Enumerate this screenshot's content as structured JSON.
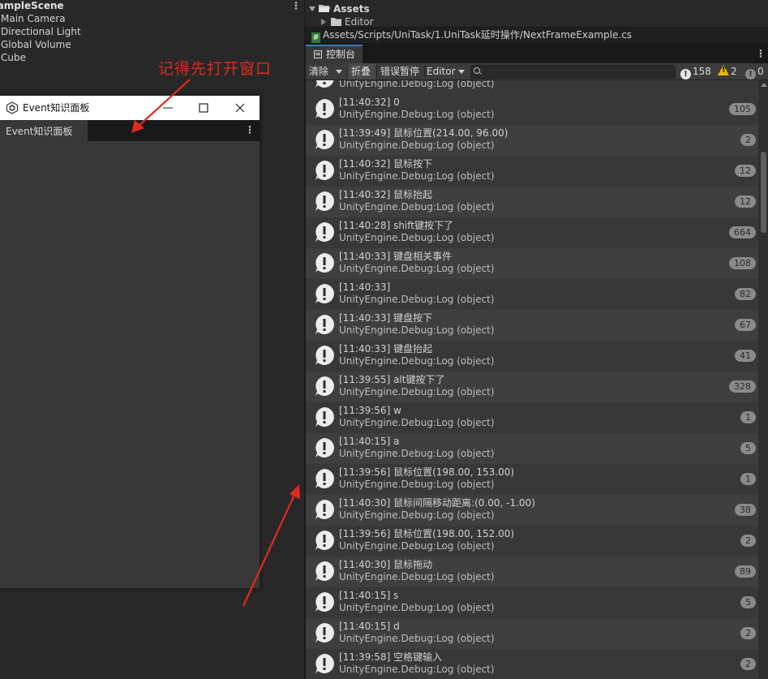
{
  "hierarchy": {
    "scene_name": "SampleScene",
    "items": [
      "Main Camera",
      "Directional Light",
      "Global Volume",
      "Cube"
    ]
  },
  "floating_window": {
    "title": "Event知识面板",
    "tab_label": "Event知识面板"
  },
  "annotation": {
    "text": "记得先打开窗口",
    "color": "#e02a1f"
  },
  "project": {
    "root": "Assets",
    "child": "Editor",
    "path": "Assets/Scripts/UniTask/1.UniTask延时操作/NextFrameExample.cs"
  },
  "console": {
    "tab_label": "控制台",
    "toolbar": {
      "clear": "清除",
      "collapse": "折叠",
      "error_pause": "错误暂停",
      "editor": "Editor",
      "search_placeholder": "",
      "info_count": "158",
      "warning_count": "2",
      "error_count": "0"
    },
    "partial_top_line": "UnityEngine.Debug:Log (object)",
    "entries": [
      {
        "message": "[11:40:32] 0",
        "source": "UnityEngine.Debug:Log (object)",
        "count": "105"
      },
      {
        "message": "[11:39:49] 鼠标位置(214.00, 96.00)",
        "source": "UnityEngine.Debug:Log (object)",
        "count": "2"
      },
      {
        "message": "[11:40:32] 鼠标按下",
        "source": "UnityEngine.Debug:Log (object)",
        "count": "12"
      },
      {
        "message": "[11:40:32] 鼠标抬起",
        "source": "UnityEngine.Debug:Log (object)",
        "count": "12"
      },
      {
        "message": "[11:40:28] shift键按下了",
        "source": "UnityEngine.Debug:Log (object)",
        "count": "664"
      },
      {
        "message": "[11:40:33] 键盘相关事件",
        "source": "UnityEngine.Debug:Log (object)",
        "count": "108"
      },
      {
        "message": "[11:40:33]",
        "source": "UnityEngine.Debug:Log (object)",
        "count": "82"
      },
      {
        "message": "[11:40:33] 键盘按下",
        "source": "UnityEngine.Debug:Log (object)",
        "count": "67"
      },
      {
        "message": "[11:40:33] 键盘抬起",
        "source": "UnityEngine.Debug:Log (object)",
        "count": "41"
      },
      {
        "message": "[11:39:55] alt键按下了",
        "source": "UnityEngine.Debug:Log (object)",
        "count": "328"
      },
      {
        "message": "[11:39:56] w",
        "source": "UnityEngine.Debug:Log (object)",
        "count": "1"
      },
      {
        "message": "[11:40:15] a",
        "source": "UnityEngine.Debug:Log (object)",
        "count": "5"
      },
      {
        "message": "[11:39:56] 鼠标位置(198.00, 153.00)",
        "source": "UnityEngine.Debug:Log (object)",
        "count": "1"
      },
      {
        "message": "[11:40:30] 鼠标间隔移动距离:(0.00, -1.00)",
        "source": "UnityEngine.Debug:Log (object)",
        "count": "38"
      },
      {
        "message": "[11:39:56] 鼠标位置(198.00, 152.00)",
        "source": "UnityEngine.Debug:Log (object)",
        "count": "2"
      },
      {
        "message": "[11:40:30] 鼠标拖动",
        "source": "UnityEngine.Debug:Log (object)",
        "count": "89"
      },
      {
        "message": "[11:40:15] s",
        "source": "UnityEngine.Debug:Log (object)",
        "count": "5"
      },
      {
        "message": "[11:40:15] d",
        "source": "UnityEngine.Debug:Log (object)",
        "count": "2"
      },
      {
        "message": "[11:39:58] 空格键输入",
        "source": "UnityEngine.Debug:Log (object)",
        "count": "2"
      }
    ]
  }
}
